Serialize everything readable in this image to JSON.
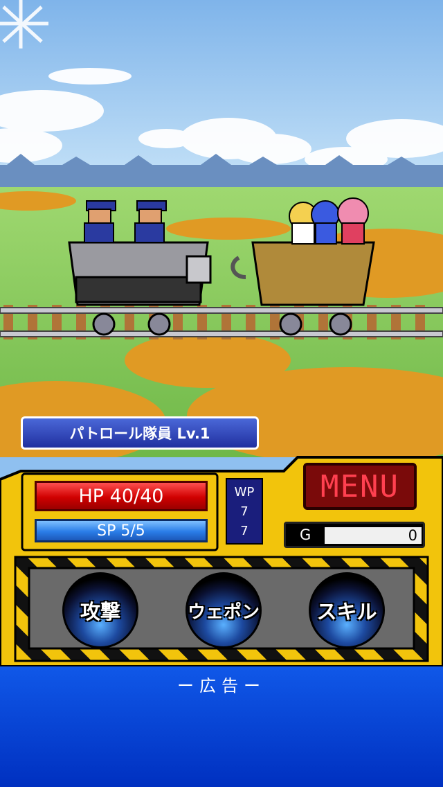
{
  "enemy": {
    "name_level": "パトロール隊員 Lv.1"
  },
  "status": {
    "hp_text": "HP 40/40",
    "sp_text": "SP 5/5",
    "wp_label": "WP",
    "wp_current": "7",
    "wp_max": "7"
  },
  "menu": {
    "label": "MENU"
  },
  "gold": {
    "label": "G",
    "value": "0"
  },
  "commands": {
    "attack": "攻撃",
    "weapon": "ウェポン",
    "skill": "スキル"
  },
  "ad": {
    "label": "ー広告ー"
  },
  "colors": {
    "panel_yellow": "#f2c40c",
    "ad_blue": "#0a46d8",
    "hp_red": "#d00000",
    "sp_blue": "#2a7de8"
  }
}
